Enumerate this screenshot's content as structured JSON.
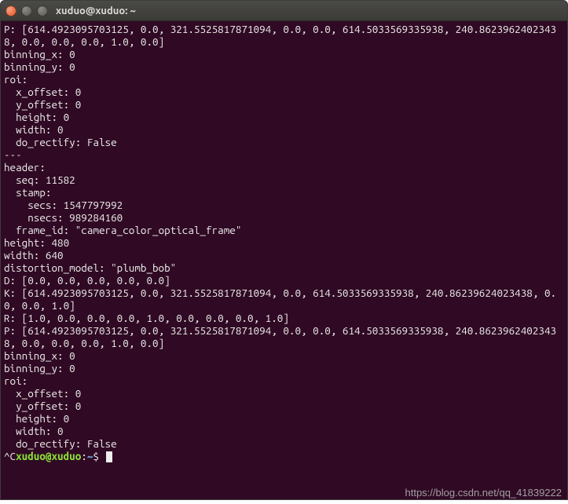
{
  "window": {
    "title": "xuduo@xuduo: ~"
  },
  "block1": {
    "P_prefix": "P: [",
    "P_values": "614.4923095703125, 0.0, 321.5525817871094, 0.0, 0.0, 614.5033569335938, 240.86239624023438, 0.0, 0.0, 0.0, 1.0, 0.0",
    "P_suffix": "]",
    "binning_x": "binning_x: 0",
    "binning_y": "binning_y: 0",
    "roi_label": "roi:",
    "x_offset": "  x_offset: 0",
    "y_offset": "  y_offset: 0",
    "height": "  height: 0",
    "width": "  width: 0",
    "do_rectify": "  do_rectify: False"
  },
  "divider": "---",
  "header": {
    "header_label": "header:",
    "seq": "  seq: 11582",
    "stamp": "  stamp:",
    "secs": "    secs: 1547797992",
    "nsecs": "    nsecs: 989284160",
    "frame": "  frame_id: \"camera_color_optical_frame\""
  },
  "info": {
    "height": "height: 480",
    "width": "width: 640",
    "distortion": "distortion_model: \"plumb_bob\"",
    "D": "D: [0.0, 0.0, 0.0, 0.0, 0.0]",
    "K": "K: [614.4923095703125, 0.0, 321.5525817871094, 0.0, 614.5033569335938, 240.86239624023438, 0.0, 0.0, 1.0]",
    "R": "R: [1.0, 0.0, 0.0, 0.0, 1.0, 0.0, 0.0, 0.0, 1.0]",
    "P_prefix": "P: [",
    "P_values": "614.4923095703125, 0.0, 321.5525817871094, 0.0, 0.0, 614.5033569335938, 240.86239624023438, 0.0, 0.0, 0.0, 1.0, 0.0",
    "P_suffix": "]"
  },
  "block2": {
    "binning_x": "binning_x: 0",
    "binning_y": "binning_y: 0",
    "roi_label": "roi:",
    "x_offset": "  x_offset: 0",
    "y_offset": "  y_offset: 0",
    "height": "  height: 0",
    "width": "  width: 0",
    "do_rectify": "  do_rectify: False"
  },
  "interrupt": "^C",
  "prompt": {
    "user_host": "xuduo@xuduo",
    "colon": ":",
    "path": "~",
    "dollar": "$ "
  },
  "watermark": "https://blog.csdn.net/qq_41839222"
}
